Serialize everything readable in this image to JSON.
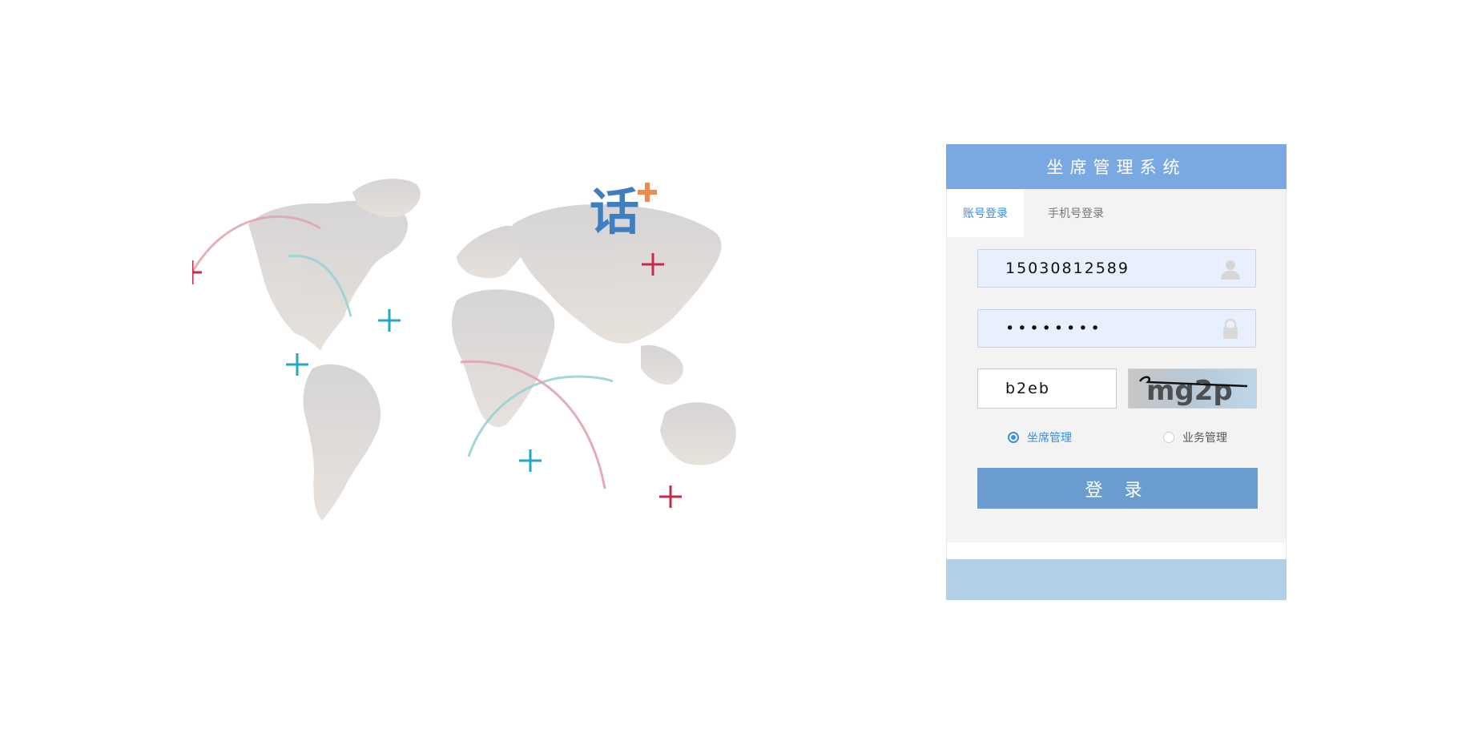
{
  "system_title": "坐席管理系统",
  "tabs": [
    {
      "label": "账号登录",
      "active": true
    },
    {
      "label": "手机号登录",
      "active": false
    }
  ],
  "form": {
    "username": "15030812589",
    "password": "••••••••",
    "captcha_input": "b2eb",
    "captcha_image_text": "mg2p"
  },
  "roles": [
    {
      "label": "坐席管理",
      "selected": true
    },
    {
      "label": "业务管理",
      "selected": false
    }
  ],
  "login_button": "登 录",
  "logo_text": "话",
  "colors": {
    "header": "#7aa8e2",
    "tab_active_text": "#2f8ff0",
    "button": "#6b9ccf",
    "footer": "#b0d0ea",
    "logo_blue": "#3f7fc0",
    "logo_orange": "#f08a4b",
    "marker_red": "#c8284a",
    "marker_teal": "#22a7c8"
  }
}
